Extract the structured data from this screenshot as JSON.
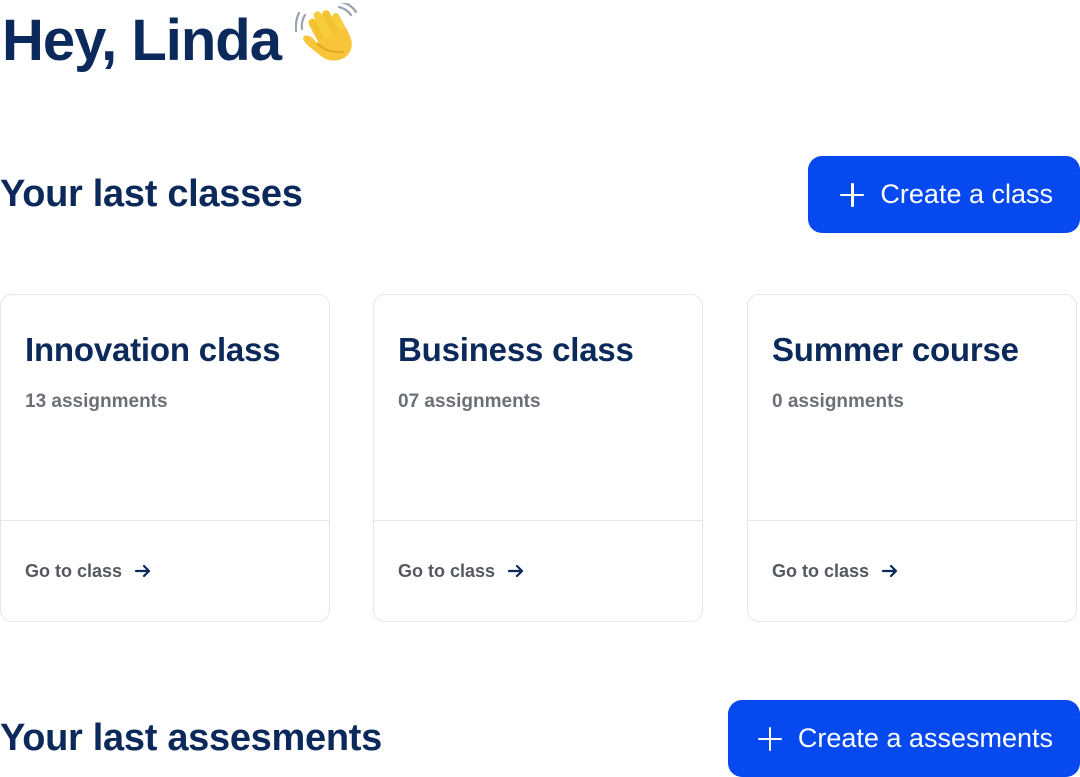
{
  "greeting": {
    "text": "Hey, Linda",
    "emoji_icon": "waving-hand-icon"
  },
  "classes_section": {
    "title": "Your last classes",
    "create_button_label": "Create a class",
    "cards": [
      {
        "title": "Innovation class",
        "meta": "13 assignments",
        "link_label": "Go to class"
      },
      {
        "title": "Business class",
        "meta": "07 assignments",
        "link_label": "Go to class"
      },
      {
        "title": "Summer course",
        "meta": "0 assignments",
        "link_label": "Go to class"
      }
    ]
  },
  "assessments_section": {
    "title": "Your last assesments",
    "create_button_label": "Create a assesments"
  },
  "colors": {
    "primary": "#0549ef",
    "heading": "#0b2a5b",
    "muted": "#6b6f76",
    "border": "#e3e6ec"
  }
}
